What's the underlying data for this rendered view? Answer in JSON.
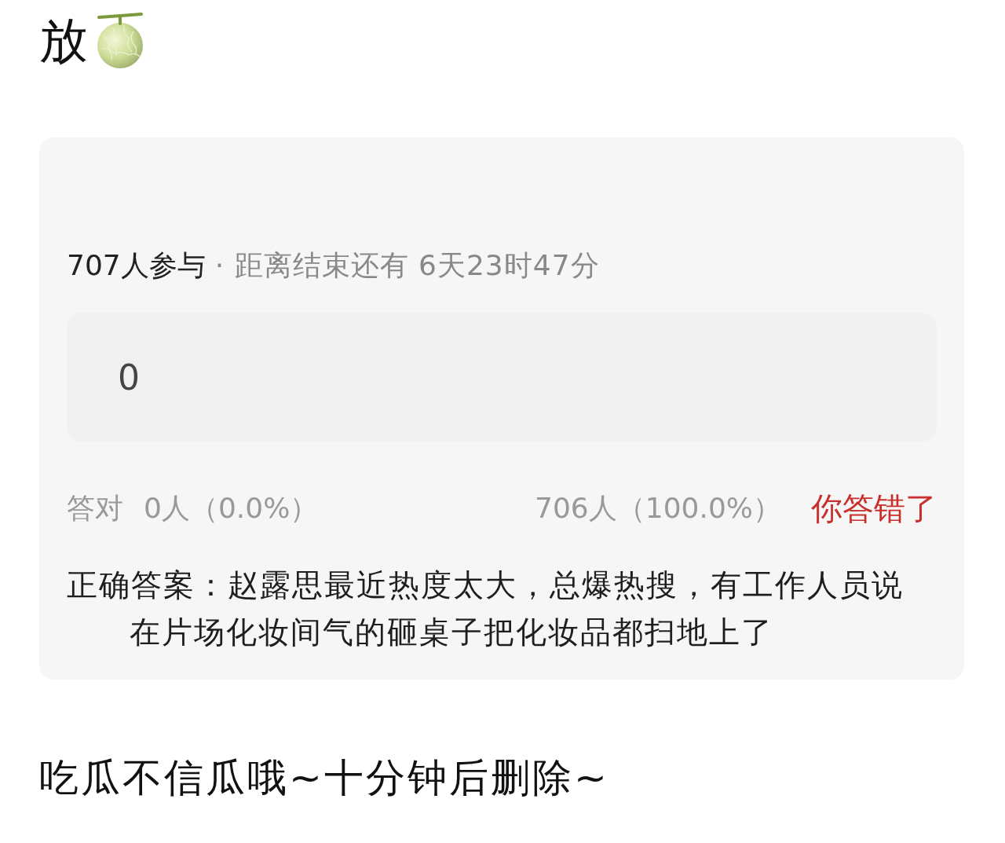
{
  "post": {
    "title": "放"
  },
  "quiz": {
    "participants": "707人参与",
    "countdown": "· 距离结束还有 6天23时47分",
    "options": [
      {
        "label": "0"
      }
    ],
    "results": {
      "correct_label": "答对",
      "correct_count": "0人（0.0%）",
      "wrong_count": "706人（100.0%）",
      "verdict": "你答错了"
    },
    "correct_answer": [
      "正确答案：赵露思最近热度太大，总爆热搜，有工作人员说",
      "在片场化妆间气的砸桌子把化妆品都扫地上了"
    ]
  },
  "footer_text": "吃瓜不信瓜哦~十分钟后删除~"
}
